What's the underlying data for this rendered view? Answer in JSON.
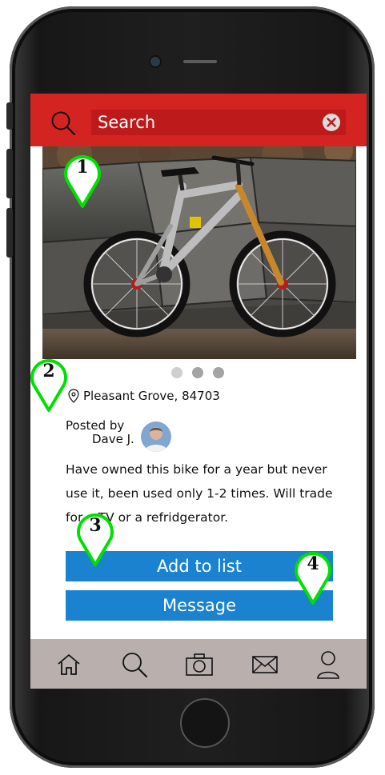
{
  "header": {
    "search_placeholder": "Search",
    "accent_color": "#d42422",
    "icons": {
      "search": "search-icon",
      "clear": "clear-icon"
    }
  },
  "listing": {
    "photo_subject": "mountain-bike-photo",
    "carousel": {
      "count": 3,
      "active_index": 1
    },
    "location": "Pleasant Grove, 84703",
    "posted_by_label": "Posted by",
    "poster_name": "Dave J.",
    "description": "Have owned this bike for a year but never use it, been used only 1-2 times. Will trade for a TV or a refridgerator."
  },
  "actions": {
    "add_to_list": "Add to list",
    "message": "Message",
    "button_color": "#1a82cf"
  },
  "tabbar": {
    "items": [
      {
        "id": "home",
        "icon": "home-icon"
      },
      {
        "id": "search",
        "icon": "search-icon"
      },
      {
        "id": "camera",
        "icon": "camera-icon"
      },
      {
        "id": "messages",
        "icon": "mail-icon"
      },
      {
        "id": "profile",
        "icon": "user-icon"
      }
    ]
  },
  "annotations": {
    "markers": [
      "1",
      "2",
      "3",
      "4"
    ],
    "color": "#00e000"
  }
}
